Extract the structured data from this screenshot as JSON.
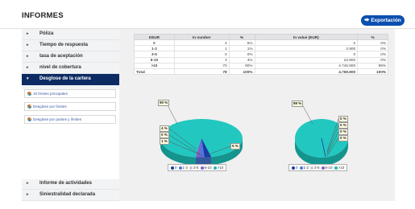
{
  "header": {
    "title": "INFORMES",
    "export_label": "Exportación"
  },
  "sidebar": {
    "items": [
      {
        "label": "Póliza"
      },
      {
        "label": "Tiempo de respuesta"
      },
      {
        "label": "tasa de aceptación"
      },
      {
        "label": "nivel de cobertura"
      },
      {
        "label": "Desglose de la cartera"
      }
    ],
    "sub_items": [
      {
        "label": "10 límites principales"
      },
      {
        "label": "Desglose por límites"
      },
      {
        "label": "Desglose por países y límites"
      }
    ],
    "bottom_items": [
      {
        "label": "Informe de actividades"
      },
      {
        "label": "Siniestralidad declarada"
      }
    ]
  },
  "table": {
    "headers": [
      "KEUR",
      "In number",
      "%",
      "In value (EUR)",
      "%"
    ],
    "rows": [
      [
        "0",
        "4",
        "5%",
        "0",
        "0%"
      ],
      [
        "1-2",
        "1",
        "1%",
        "2.900",
        "0%"
      ],
      [
        "3-5",
        "0",
        "0%",
        "0",
        "0%"
      ],
      [
        "6-10",
        "3",
        "4%",
        "22.900",
        "0%"
      ],
      [
        ">10",
        "70",
        "90%",
        "4.746.900",
        "99%"
      ],
      [
        "Total",
        "78",
        "100%",
        "4.769.800",
        "100%"
      ]
    ]
  },
  "charts": {
    "left": {
      "labels": [
        "90 %",
        "4 %",
        "0 %",
        "1 %",
        "5 %"
      ]
    },
    "right": {
      "labels": [
        "99 %",
        "0 %",
        "0 %",
        "0 %",
        "0 %"
      ]
    },
    "legend": [
      {
        "label": "0",
        "color": "#1a3aa8"
      },
      {
        "label": "1-2",
        "color": "#4a7ad8"
      },
      {
        "label": "3-5",
        "color": "#c8c8c8"
      },
      {
        "label": "6-10",
        "color": "#8a5ad0"
      },
      {
        "label": ">10",
        "color": "#1fb8b0"
      }
    ]
  },
  "colors": {
    "primary": "#0c2b63",
    "accent": "#0b4fb0",
    "pie_main": "#22c7c0"
  }
}
